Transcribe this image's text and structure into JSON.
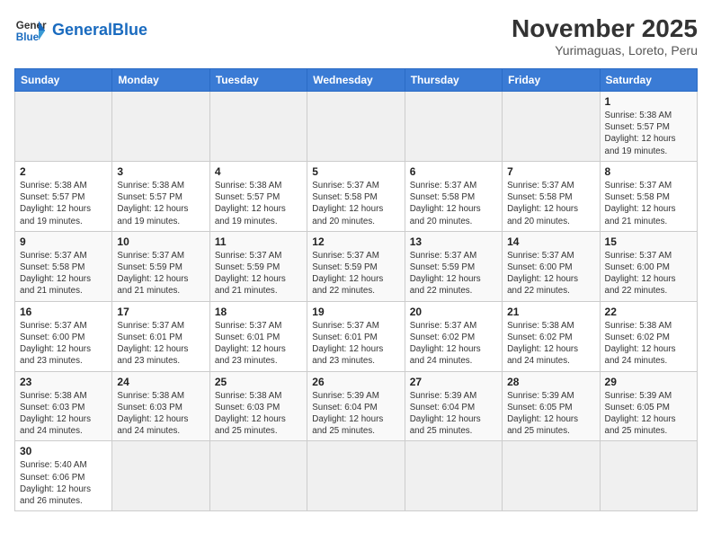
{
  "header": {
    "logo_general": "General",
    "logo_blue": "Blue",
    "month_title": "November 2025",
    "subtitle": "Yurimaguas, Loreto, Peru"
  },
  "weekdays": [
    "Sunday",
    "Monday",
    "Tuesday",
    "Wednesday",
    "Thursday",
    "Friday",
    "Saturday"
  ],
  "weeks": [
    [
      {
        "day": "",
        "info": ""
      },
      {
        "day": "",
        "info": ""
      },
      {
        "day": "",
        "info": ""
      },
      {
        "day": "",
        "info": ""
      },
      {
        "day": "",
        "info": ""
      },
      {
        "day": "",
        "info": ""
      },
      {
        "day": "1",
        "info": "Sunrise: 5:38 AM\nSunset: 5:57 PM\nDaylight: 12 hours and 19 minutes."
      }
    ],
    [
      {
        "day": "2",
        "info": "Sunrise: 5:38 AM\nSunset: 5:57 PM\nDaylight: 12 hours and 19 minutes."
      },
      {
        "day": "3",
        "info": "Sunrise: 5:38 AM\nSunset: 5:57 PM\nDaylight: 12 hours and 19 minutes."
      },
      {
        "day": "4",
        "info": "Sunrise: 5:38 AM\nSunset: 5:57 PM\nDaylight: 12 hours and 19 minutes."
      },
      {
        "day": "5",
        "info": "Sunrise: 5:37 AM\nSunset: 5:58 PM\nDaylight: 12 hours and 20 minutes."
      },
      {
        "day": "6",
        "info": "Sunrise: 5:37 AM\nSunset: 5:58 PM\nDaylight: 12 hours and 20 minutes."
      },
      {
        "day": "7",
        "info": "Sunrise: 5:37 AM\nSunset: 5:58 PM\nDaylight: 12 hours and 20 minutes."
      },
      {
        "day": "8",
        "info": "Sunrise: 5:37 AM\nSunset: 5:58 PM\nDaylight: 12 hours and 21 minutes."
      }
    ],
    [
      {
        "day": "9",
        "info": "Sunrise: 5:37 AM\nSunset: 5:58 PM\nDaylight: 12 hours and 21 minutes."
      },
      {
        "day": "10",
        "info": "Sunrise: 5:37 AM\nSunset: 5:59 PM\nDaylight: 12 hours and 21 minutes."
      },
      {
        "day": "11",
        "info": "Sunrise: 5:37 AM\nSunset: 5:59 PM\nDaylight: 12 hours and 21 minutes."
      },
      {
        "day": "12",
        "info": "Sunrise: 5:37 AM\nSunset: 5:59 PM\nDaylight: 12 hours and 22 minutes."
      },
      {
        "day": "13",
        "info": "Sunrise: 5:37 AM\nSunset: 5:59 PM\nDaylight: 12 hours and 22 minutes."
      },
      {
        "day": "14",
        "info": "Sunrise: 5:37 AM\nSunset: 6:00 PM\nDaylight: 12 hours and 22 minutes."
      },
      {
        "day": "15",
        "info": "Sunrise: 5:37 AM\nSunset: 6:00 PM\nDaylight: 12 hours and 22 minutes."
      }
    ],
    [
      {
        "day": "16",
        "info": "Sunrise: 5:37 AM\nSunset: 6:00 PM\nDaylight: 12 hours and 23 minutes."
      },
      {
        "day": "17",
        "info": "Sunrise: 5:37 AM\nSunset: 6:01 PM\nDaylight: 12 hours and 23 minutes."
      },
      {
        "day": "18",
        "info": "Sunrise: 5:37 AM\nSunset: 6:01 PM\nDaylight: 12 hours and 23 minutes."
      },
      {
        "day": "19",
        "info": "Sunrise: 5:37 AM\nSunset: 6:01 PM\nDaylight: 12 hours and 23 minutes."
      },
      {
        "day": "20",
        "info": "Sunrise: 5:37 AM\nSunset: 6:02 PM\nDaylight: 12 hours and 24 minutes."
      },
      {
        "day": "21",
        "info": "Sunrise: 5:38 AM\nSunset: 6:02 PM\nDaylight: 12 hours and 24 minutes."
      },
      {
        "day": "22",
        "info": "Sunrise: 5:38 AM\nSunset: 6:02 PM\nDaylight: 12 hours and 24 minutes."
      }
    ],
    [
      {
        "day": "23",
        "info": "Sunrise: 5:38 AM\nSunset: 6:03 PM\nDaylight: 12 hours and 24 minutes."
      },
      {
        "day": "24",
        "info": "Sunrise: 5:38 AM\nSunset: 6:03 PM\nDaylight: 12 hours and 24 minutes."
      },
      {
        "day": "25",
        "info": "Sunrise: 5:38 AM\nSunset: 6:03 PM\nDaylight: 12 hours and 25 minutes."
      },
      {
        "day": "26",
        "info": "Sunrise: 5:39 AM\nSunset: 6:04 PM\nDaylight: 12 hours and 25 minutes."
      },
      {
        "day": "27",
        "info": "Sunrise: 5:39 AM\nSunset: 6:04 PM\nDaylight: 12 hours and 25 minutes."
      },
      {
        "day": "28",
        "info": "Sunrise: 5:39 AM\nSunset: 6:05 PM\nDaylight: 12 hours and 25 minutes."
      },
      {
        "day": "29",
        "info": "Sunrise: 5:39 AM\nSunset: 6:05 PM\nDaylight: 12 hours and 25 minutes."
      }
    ],
    [
      {
        "day": "30",
        "info": "Sunrise: 5:40 AM\nSunset: 6:06 PM\nDaylight: 12 hours and 26 minutes."
      },
      {
        "day": "",
        "info": ""
      },
      {
        "day": "",
        "info": ""
      },
      {
        "day": "",
        "info": ""
      },
      {
        "day": "",
        "info": ""
      },
      {
        "day": "",
        "info": ""
      },
      {
        "day": "",
        "info": ""
      }
    ]
  ]
}
